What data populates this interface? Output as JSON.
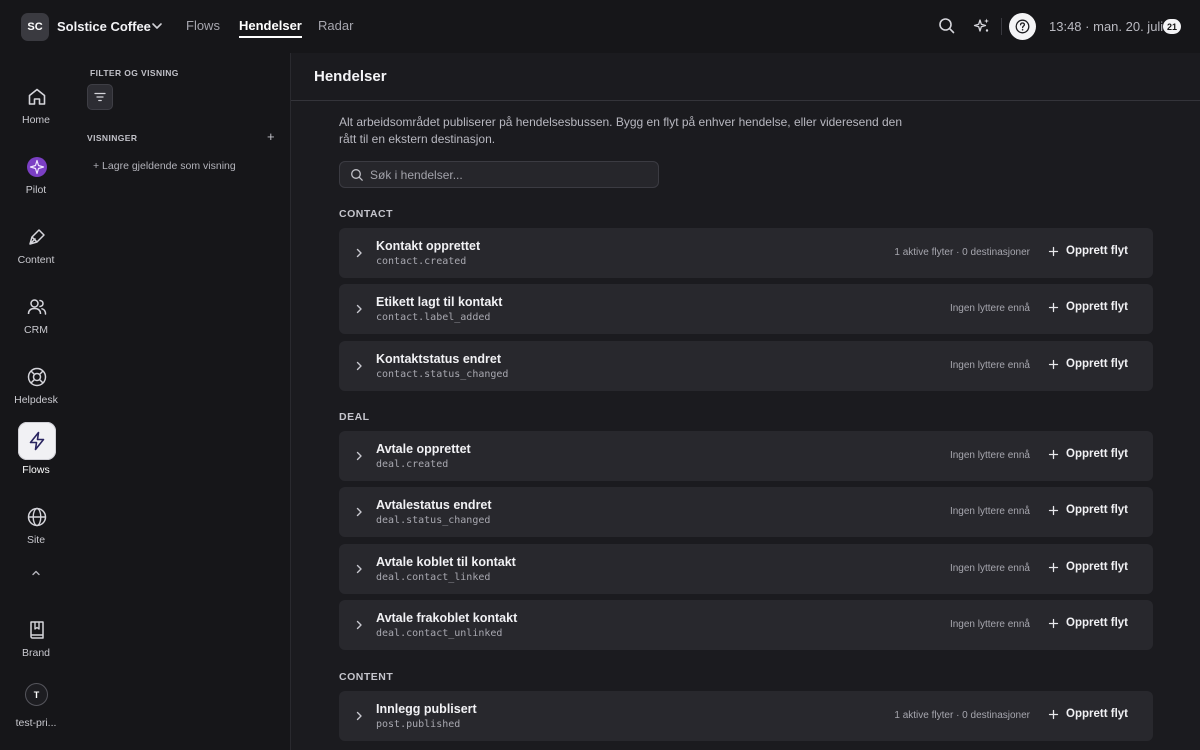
{
  "workspace": {
    "initials": "SC",
    "name": "Solstice Coffee"
  },
  "nav": {
    "tabs": [
      "Flows",
      "Hendelser",
      "Radar"
    ],
    "active": "Hendelser"
  },
  "topbar": {
    "time": "13:48",
    "date": "man. 20. juli",
    "badge": "21"
  },
  "rail": {
    "items": [
      {
        "label": "Home",
        "icon": "home-icon"
      },
      {
        "label": "Pilot",
        "icon": "pilot-icon"
      },
      {
        "label": "Content",
        "icon": "pen-icon"
      },
      {
        "label": "CRM",
        "icon": "users-icon"
      },
      {
        "label": "Helpdesk",
        "icon": "lifebuoy-icon"
      },
      {
        "label": "Flows",
        "icon": "bolt-icon"
      },
      {
        "label": "Site",
        "icon": "globe-icon"
      },
      {
        "label": "Brand",
        "icon": "book-icon"
      }
    ],
    "active": "Flows",
    "user": {
      "initial": "T",
      "label": "test-pri..."
    }
  },
  "panel": {
    "filter_heading": "FILTER OG VISNING",
    "views_heading": "VISNINGER",
    "add_view": "+",
    "save_view": "+ Lagre gjeldende som visning"
  },
  "main": {
    "title": "Hendelser",
    "description": "Alt arbeidsområdet publiserer på hendelsesbussen. Bygg en flyt på enhver hendelse, eller videresend den rått til en ekstern destinasjon.",
    "search_placeholder": "Søk i hendelser..."
  },
  "create_label": "Opprett flyt",
  "groups": [
    {
      "title": "CONTACT",
      "events": [
        {
          "title": "Kontakt opprettet",
          "code": "contact.created",
          "status": "1 aktive flyter · 0 destinasjoner"
        },
        {
          "title": "Etikett lagt til kontakt",
          "code": "contact.label_added",
          "status": "Ingen lyttere ennå"
        },
        {
          "title": "Kontaktstatus endret",
          "code": "contact.status_changed",
          "status": "Ingen lyttere ennå"
        }
      ]
    },
    {
      "title": "DEAL",
      "events": [
        {
          "title": "Avtale opprettet",
          "code": "deal.created",
          "status": "Ingen lyttere ennå"
        },
        {
          "title": "Avtalestatus endret",
          "code": "deal.status_changed",
          "status": "Ingen lyttere ennå"
        },
        {
          "title": "Avtale koblet til kontakt",
          "code": "deal.contact_linked",
          "status": "Ingen lyttere ennå"
        },
        {
          "title": "Avtale frakoblet kontakt",
          "code": "deal.contact_unlinked",
          "status": "Ingen lyttere ennå"
        }
      ]
    },
    {
      "title": "CONTENT",
      "events": [
        {
          "title": "Innlegg publisert",
          "code": "post.published",
          "status": "1 aktive flyter · 0 destinasjoner"
        }
      ]
    }
  ]
}
